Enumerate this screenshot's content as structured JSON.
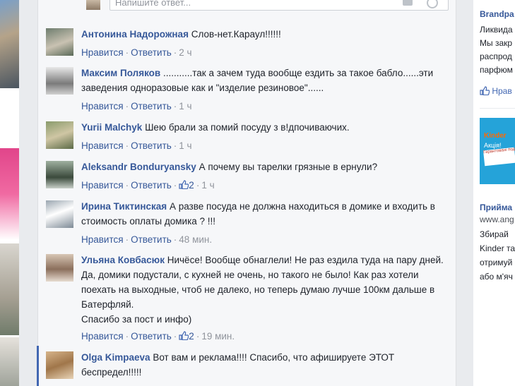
{
  "reply_box": {
    "placeholder": "Напишите ответ..."
  },
  "actions": {
    "like": "Нравится",
    "reply": "Ответить"
  },
  "comments": [
    {
      "author": "Антонина Надорожная",
      "text": "Слов-нет.Караул!!!!!!",
      "time": "2 ч",
      "likes": ""
    },
    {
      "author": "Максим Поляков",
      "text": "...........так а зачем туда вообще ездить за такое бабло......эти заведения одноразовые как и \"изделие резиновое\"......",
      "time": "1 ч",
      "likes": ""
    },
    {
      "author": "Yurii Malchyk",
      "text": "Шею брали за помий посуду з в!дпочиваючих.",
      "time": "1 ч",
      "likes": ""
    },
    {
      "author": "Aleksandr Bonduryansky",
      "text": "А почему вы тарелки грязные в ернули?",
      "time": "1 ч",
      "likes": "2"
    },
    {
      "author": "Ирина Тиктинская",
      "text": "А разве посуда не должна находиться в домике и входить в стоимость оплаты домика ? !!!",
      "time": "48 мин.",
      "likes": ""
    },
    {
      "author": "Ульяна Ковбасюк",
      "text": "Ничёсе! Вообще обнаглели! Не раз ездила туда на пару дней. Да, домики подустали, с кухней не очень, но такого не было! Как раз хотели поехать на выходные, чтоб не далеко, но теперь думаю лучше 100км дальше в Батерфляй.",
      "text2": "Спасибо за пост и инфо)",
      "time": "19 мин.",
      "likes": "2"
    },
    {
      "author": "Olga Kimpaeva",
      "text": "Вот вам и реклама!!!! Спасибо, что афишируете ЭТОТ беспредел!!!!!",
      "time": "",
      "likes": ""
    }
  ],
  "sidebar": {
    "ad1_title": "Brandpa",
    "ad1_line1": "Ликвида",
    "ad1_line2": "Мы закр",
    "ad1_line3": "распрод",
    "ad1_line4": "парфюм",
    "ad1_like": "Нрав",
    "ad2_image_brand": "Kinder",
    "ad2_image_line1": "Акція!",
    "ad2_image_line2": "Гарантовані подарунки!",
    "ad2_title": "Прийма",
    "ad2_url": "www.ang",
    "ad2_line1": "Збирай",
    "ad2_line2": "Kinder та",
    "ad2_line3": "отримуй",
    "ad2_line4": "або м'яч"
  }
}
